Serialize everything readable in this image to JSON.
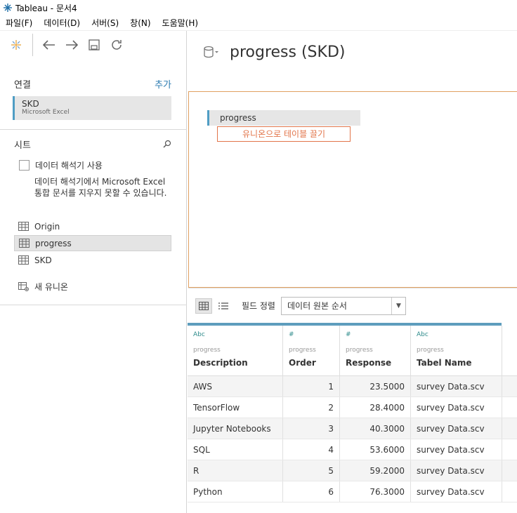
{
  "window": {
    "title": "Tableau - 문서4"
  },
  "menu": [
    "파일(F)",
    "데이터(D)",
    "서버(S)",
    "창(N)",
    "도움말(H)"
  ],
  "connections": {
    "label": "연결",
    "add_label": "추가",
    "items": [
      {
        "name": "SKD",
        "type": "Microsoft Excel"
      }
    ]
  },
  "sheets": {
    "label": "시트",
    "interpreter_label": "데이터 해석기 사용",
    "interpreter_desc": "데이터 해석기에서 Microsoft Excel 통합 문서를 지우지 못할 수 있습니다.",
    "items": [
      "Origin",
      "progress",
      "SKD"
    ],
    "new_union": "새 유니온"
  },
  "datasource": {
    "title": "progress (SKD)",
    "table": "progress",
    "union_drop": "유니온으로 테이블 끌기"
  },
  "gridbar": {
    "sort_label": "필드 정렬",
    "sort_value": "데이터 원본 순서"
  },
  "grid": {
    "columns": [
      {
        "type": "Abc",
        "source": "progress",
        "name": "Description"
      },
      {
        "type": "#",
        "source": "progress",
        "name": "Order"
      },
      {
        "type": "#",
        "source": "progress",
        "name": "Response"
      },
      {
        "type": "Abc",
        "source": "progress",
        "name": "Tabel Name"
      }
    ],
    "rows": [
      [
        "AWS",
        "1",
        "23.5000",
        "survey Data.scv"
      ],
      [
        "TensorFlow",
        "2",
        "28.4000",
        "survey Data.scv"
      ],
      [
        "Jupyter Notebooks",
        "3",
        "40.3000",
        "survey Data.scv"
      ],
      [
        "SQL",
        "4",
        "53.6000",
        "survey Data.scv"
      ],
      [
        "R",
        "5",
        "59.2000",
        "survey Data.scv"
      ],
      [
        "Python",
        "6",
        "76.3000",
        "survey Data.scv"
      ]
    ]
  },
  "colors": {
    "accent": "#4f9dc4",
    "link": "#2a7ab0",
    "drop": "#e2754a"
  }
}
